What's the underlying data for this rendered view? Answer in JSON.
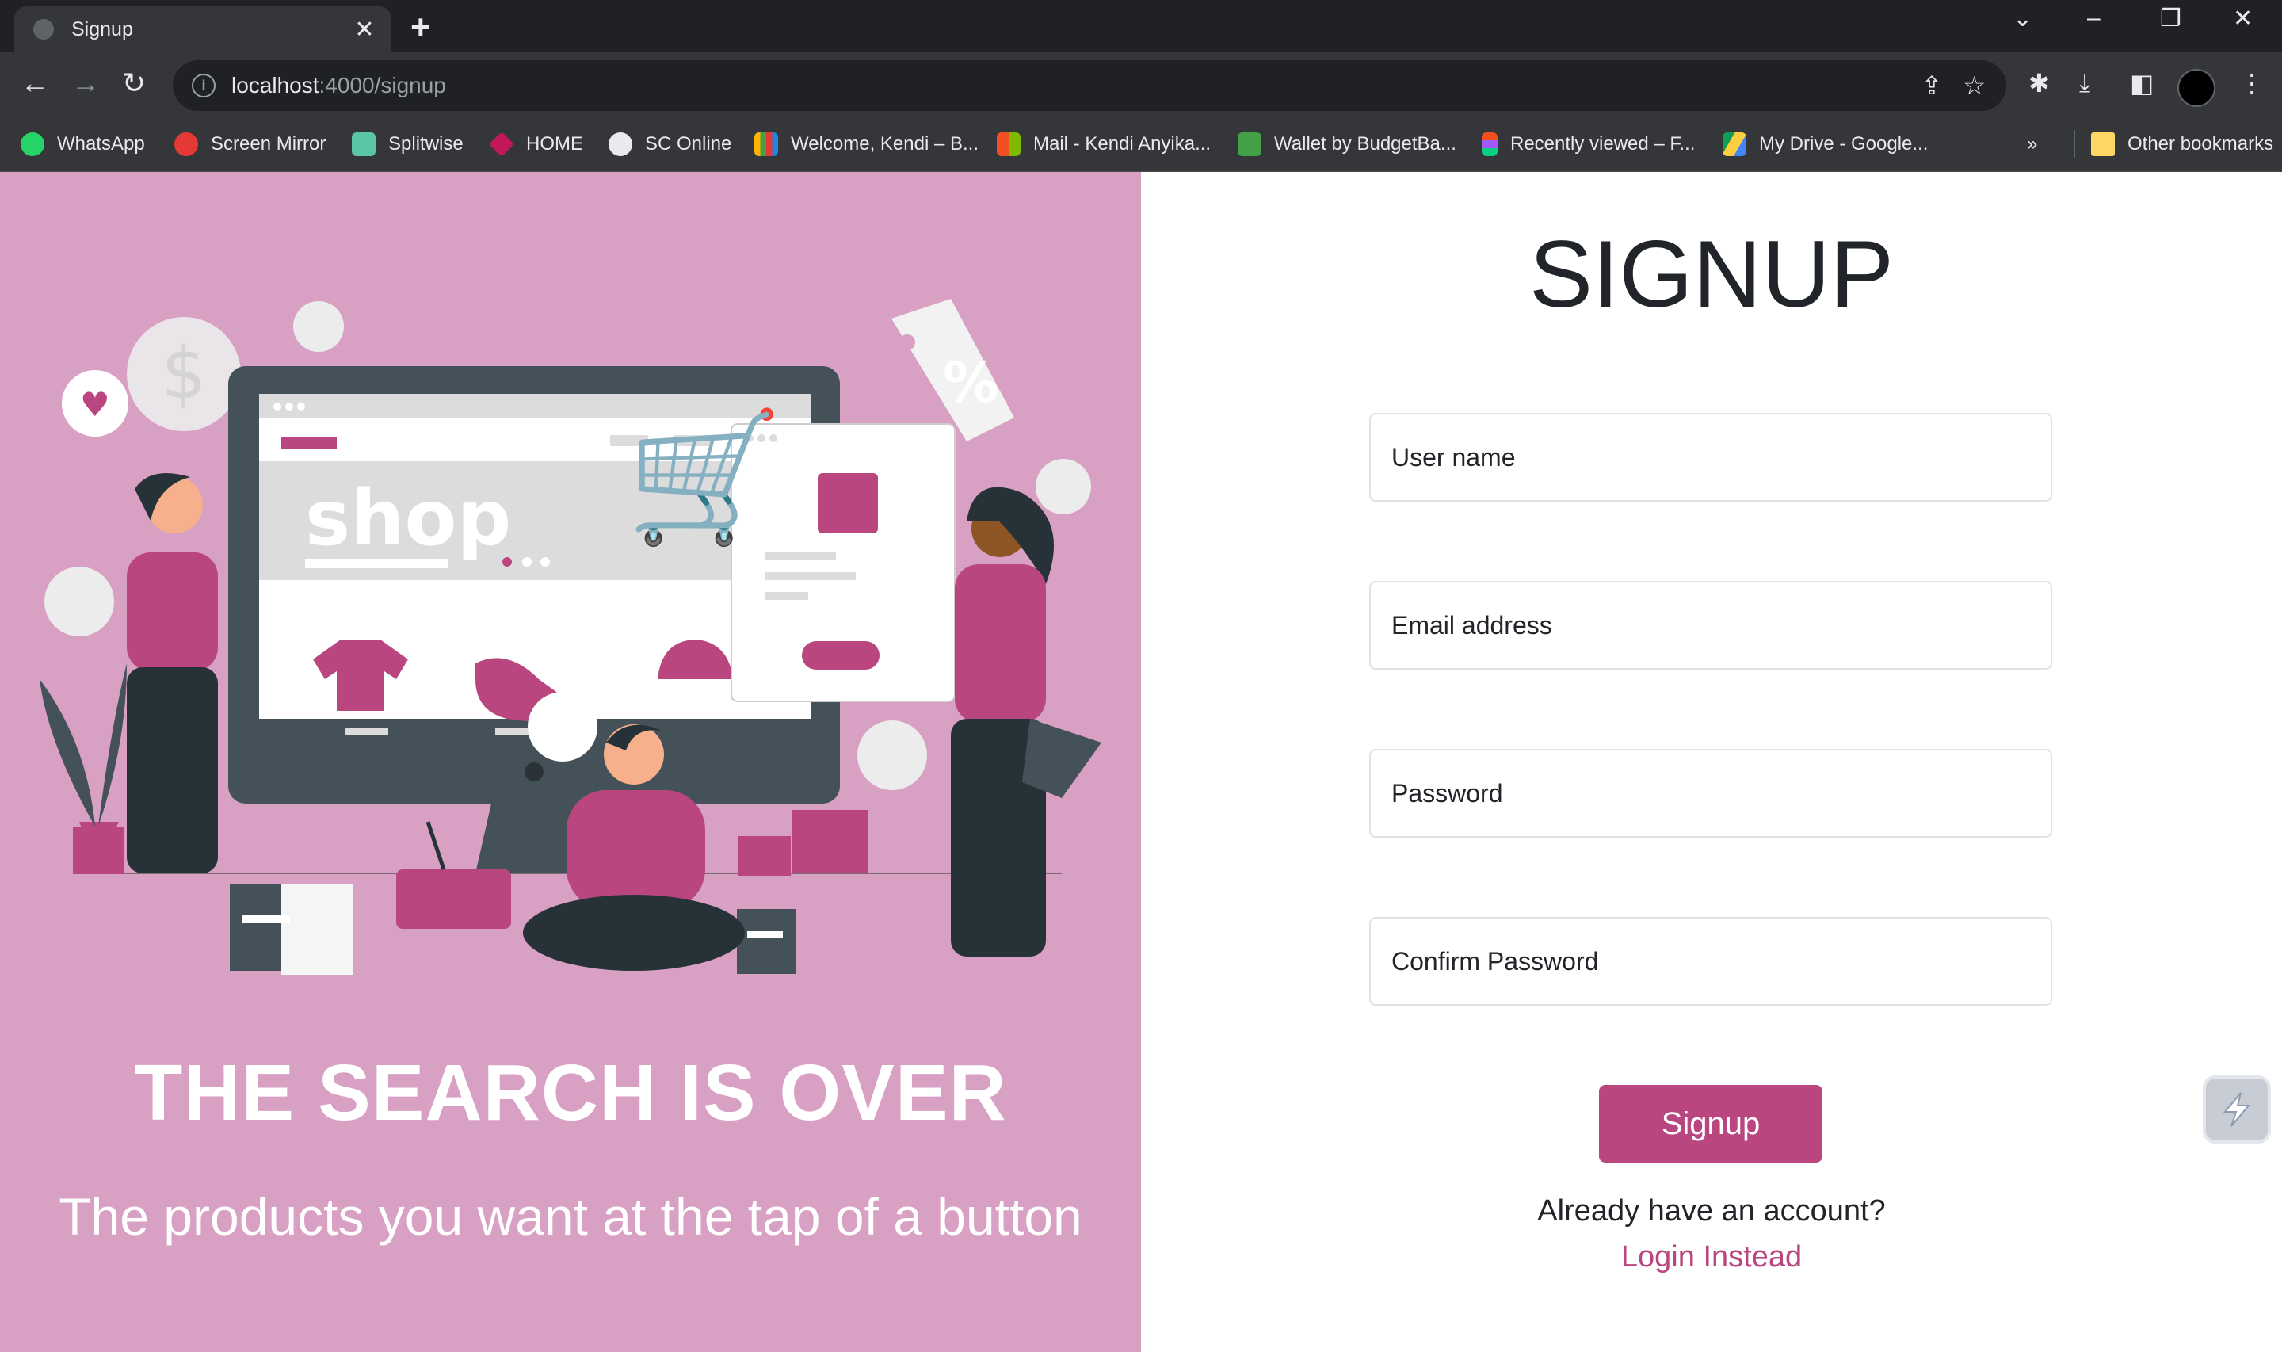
{
  "browser": {
    "tab_title": "Signup",
    "url_host": "localhost",
    "url_rest": ":4000/signup",
    "bookmarks": [
      {
        "label": "WhatsApp",
        "color": "#25d366"
      },
      {
        "label": "Screen Mirror",
        "color": "#e53935"
      },
      {
        "label": "Splitwise",
        "color": "#5bc5a7"
      },
      {
        "label": "HOME",
        "color": "#c2185b"
      },
      {
        "label": "SC Online",
        "color": "#ffffff"
      },
      {
        "label": "Welcome, Kendi – B...",
        "color": "#ffb300"
      },
      {
        "label": "Mail - Kendi Anyika...",
        "color": "#f25022"
      },
      {
        "label": "Wallet by BudgetBa...",
        "color": "#43a047"
      },
      {
        "label": "Recently viewed – F...",
        "color": "#a259ff"
      },
      {
        "label": "My Drive - Google...",
        "color": "#1e88e5"
      }
    ],
    "overflow": "»",
    "other_bookmarks": "Other bookmarks"
  },
  "hero": {
    "shop_text": "shop",
    "title": "THE SEARCH IS OVER",
    "subtitle": "The products you want at the tap of a button"
  },
  "form": {
    "title": "SIGNUP",
    "username_placeholder": "User name",
    "email_placeholder": "Email address",
    "password_placeholder": "Password",
    "confirm_placeholder": "Confirm Password",
    "submit_label": "Signup",
    "already_text": "Already have an account?",
    "login_link": "Login Instead"
  },
  "colors": {
    "accent": "#b9467f",
    "hero_bg": "#d8a0c2"
  }
}
